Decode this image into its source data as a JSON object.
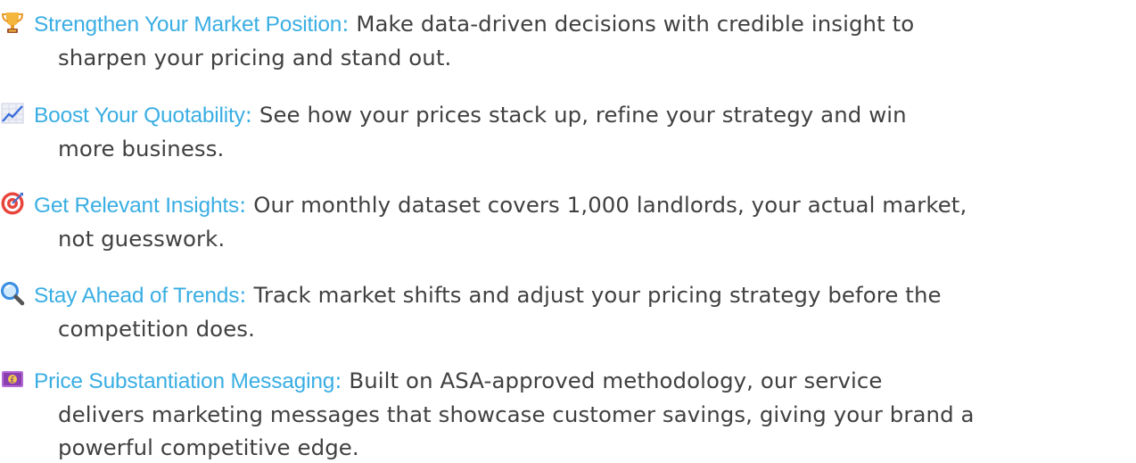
{
  "items": [
    {
      "icon": "trophy-icon",
      "title": "Strengthen Your Market Position",
      "colon": ":",
      "line1": " Make data-driven decisions with credible insight to",
      "line2": "sharpen your pricing and stand out."
    },
    {
      "icon": "chart-increasing-icon",
      "title": "Boost Your Quotability",
      "colon": ":",
      "line1": " See how your prices stack up, refine your strategy and win",
      "line2": "more business."
    },
    {
      "icon": "target-icon",
      "title": "Get Relevant Insights",
      "colon": ":",
      "line1": " Our monthly dataset covers 1,000 landlords, your actual market,",
      "line2": "not guesswork."
    },
    {
      "icon": "magnifying-glass-icon",
      "title": "Stay Ahead of Trends",
      "colon": ":",
      "line1": " Track market shifts and adjust your pricing strategy before the",
      "line2": "competition does."
    },
    {
      "icon": "pound-banknote-icon",
      "title": "Price Substantiation Messaging",
      "colon": ":",
      "line1": " Built on ASA-approved methodology, our service",
      "line2": "delivers marketing messages that showcase customer savings, giving your brand a",
      "line3": "powerful competitive edge."
    }
  ],
  "colors": {
    "title": "#3aaee3",
    "body": "#404040"
  }
}
